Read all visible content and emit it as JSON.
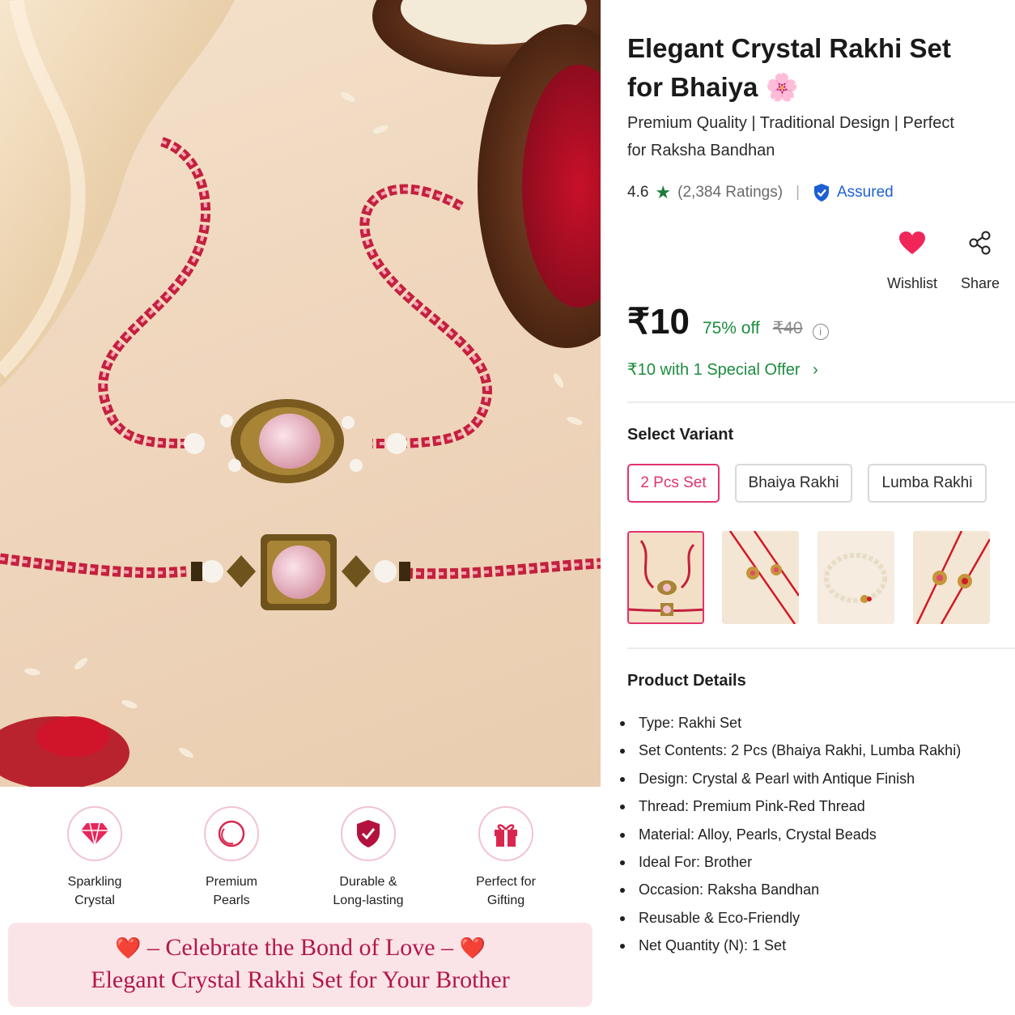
{
  "product": {
    "title": "Elegant Crystal Rakhi Set for Bhaiya",
    "title_emoji": "🌸",
    "subtitle": "Premium Quality | Traditional Design | Perfect for Raksha Bandhan",
    "rating": "4.6",
    "rating_count": "(2,384 Ratings)",
    "separator": "|",
    "assured_label": "Assured"
  },
  "actions": {
    "wishlist_label": "Wishlist",
    "share_label": "Share"
  },
  "pricing": {
    "price": "₹10",
    "discount": "75% off",
    "mrp": "₹40",
    "info_symbol": "i",
    "offer": "₹10 with 1 Special Offer"
  },
  "variants": {
    "title": "Select Variant",
    "options": [
      "2 Pcs Set",
      "Bhaiya Rakhi",
      "Lumba Rakhi"
    ],
    "selected": "2 Pcs Set"
  },
  "details": {
    "title": "Product Details",
    "items": [
      "Type: Rakhi Set",
      "Set Contents: 2 Pcs (Bhaiya Rakhi, Lumba Rakhi)",
      "Design: Crystal & Pearl with Antique Finish",
      "Thread: Premium Pink-Red Thread",
      "Material: Alloy, Pearls, Crystal Beads",
      "Ideal For: Brother",
      "Occasion: Raksha Bandhan",
      "Reusable & Eco-Friendly",
      "Net Quantity (N): 1 Set"
    ]
  },
  "features": [
    {
      "label": "Sparkling\nCrystal",
      "icon": "diamond-icon"
    },
    {
      "label": "Premium\nPearls",
      "icon": "pearl-icon"
    },
    {
      "label": "Durable &\nLong-lasting",
      "icon": "shield-icon"
    },
    {
      "label": "Perfect for\nGifting",
      "icon": "gift-icon"
    }
  ],
  "banner": {
    "heart": "❤️",
    "line1": "– Celebrate the Bond of Love –",
    "line2": "Elegant Crystal Rakhi Set for Your Brother"
  },
  "colors": {
    "accent": "#e2336b",
    "green": "#1e8c3e",
    "assured_blue": "#1e5fd6",
    "banner_text": "#b3174a",
    "banner_bg": "#fbe4e8"
  }
}
